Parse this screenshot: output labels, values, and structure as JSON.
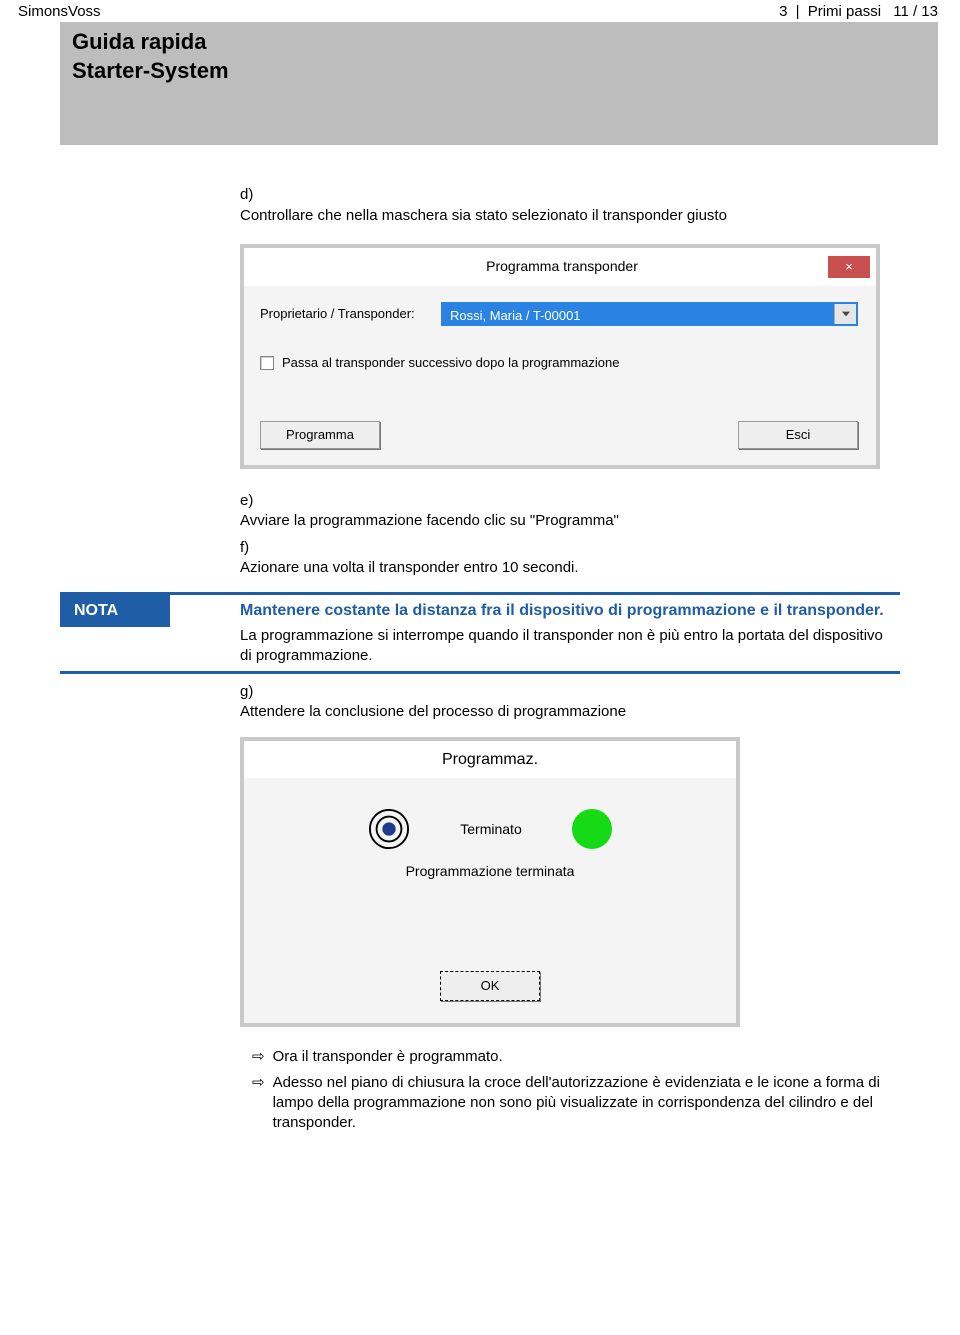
{
  "header": {
    "brand": "SimonsVoss",
    "section_num": "3",
    "section_title": "Primi passi",
    "page_indicator": "11 / 13",
    "title_line1": "Guida rapida",
    "title_line2": "Starter-System"
  },
  "steps": {
    "d_label": "d)",
    "d_text": "Controllare che nella maschera sia stato selezionato il transponder giusto",
    "e_label": "e)",
    "e_text": "Avviare la programmazione facendo clic su \"Programma\"",
    "f_label": "f)",
    "f_text": "Azionare una volta il transponder entro 10 secondi.",
    "g_label": "g)",
    "g_text": "Attendere la conclusione del processo di programmazione"
  },
  "dialog1": {
    "title": "Programma transponder",
    "close": "×",
    "field_label": "Proprietario / Transponder:",
    "field_value": "Rossi, Maria / T-00001",
    "check_label": "Passa al transponder successivo dopo la programmazione",
    "btn_program": "Programma",
    "btn_exit": "Esci"
  },
  "nota": {
    "label": "NOTA",
    "bold_text": "Mantenere costante la distanza fra il dispositivo di programmazione e il transponder.",
    "sub_text": "La programmazione si interrompe quando il transponder non è più entro la portata del dispositivo di programmazione."
  },
  "dialog2": {
    "title": "Programmaz.",
    "status": "Terminato",
    "sub": "Programmazione terminata",
    "ok": "OK"
  },
  "results": {
    "r1": "Ora il transponder è programmato.",
    "r2": "Adesso nel piano di chiusura la croce dell'autorizzazione è evidenziata e le icone a forma di lampo della programmazione non sono più visualizzate in corrispondenza del cilindro e del transponder."
  }
}
